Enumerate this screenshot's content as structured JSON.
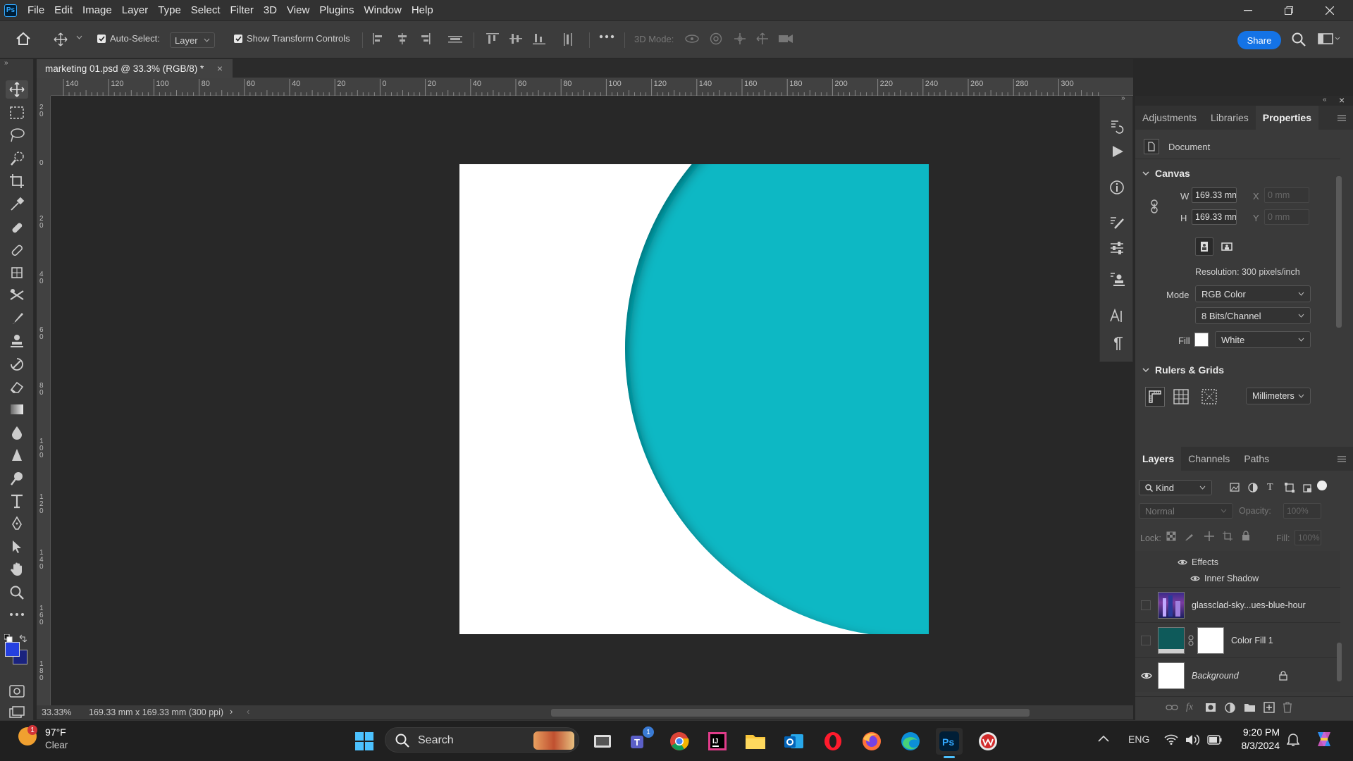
{
  "menu": [
    "File",
    "Edit",
    "Image",
    "Layer",
    "Type",
    "Select",
    "Filter",
    "3D",
    "View",
    "Plugins",
    "Window",
    "Help"
  ],
  "options": {
    "auto_select_label": "Auto-Select:",
    "auto_select_value": "Layer",
    "transform_label": "Show Transform Controls",
    "mode3d_label": "3D Mode:",
    "share_label": "Share"
  },
  "document": {
    "tab_title": "marketing 01.psd @ 33.3% (RGB/8) *",
    "zoom": "33.33%",
    "doc_info": "169.33 mm x 169.33 mm (300 ppi)",
    "shape_color": "#0bb8c4"
  },
  "ruler": {
    "h_ticks": [
      "140",
      "120",
      "100",
      "80",
      "60",
      "40",
      "20",
      "0",
      "20",
      "40",
      "60",
      "80",
      "100",
      "120",
      "140",
      "160",
      "180",
      "200",
      "220",
      "240",
      "260",
      "280",
      "300"
    ],
    "v_ticks": [
      "2\n0",
      "0",
      "2\n0",
      "4\n0",
      "6\n0",
      "8\n0",
      "1\n0\n0",
      "1\n2\n0",
      "1\n4\n0",
      "1\n6\n0",
      "1\n8\n0"
    ]
  },
  "panel_top": {
    "tabs": [
      "Adjustments",
      "Libraries",
      "Properties"
    ],
    "active_tab": "Properties",
    "doc_label": "Document",
    "canvas_head": "Canvas",
    "w_label": "W",
    "w_value": "169.33 mm",
    "h_label": "H",
    "h_value": "169.33 mm",
    "x_label": "X",
    "x_value": "0 mm",
    "y_label": "Y",
    "y_value": "0 mm",
    "resolution": "Resolution: 300 pixels/inch",
    "mode_label": "Mode",
    "mode_value": "RGB Color",
    "depth_value": "8 Bits/Channel",
    "fill_label": "Fill",
    "fill_value": "White",
    "rulers_head": "Rulers & Grids",
    "units_value": "Millimeters"
  },
  "layers_panel": {
    "tabs": [
      "Layers",
      "Channels",
      "Paths"
    ],
    "kind": "Kind",
    "blend": "Normal",
    "opacity_label": "Opacity:",
    "opacity_value": "100%",
    "lock_label": "Lock:",
    "fill_label": "Fill:",
    "fill_value": "100%",
    "effects": "Effects",
    "inner_shadow": "Inner Shadow",
    "layers": [
      {
        "name": "glassclad-sky...ues-blue-hour",
        "visible": false
      },
      {
        "name": "Color Fill 1",
        "visible": false
      },
      {
        "name": "Background",
        "visible": true
      }
    ]
  },
  "taskbar": {
    "weather_temp": "97°F",
    "weather_desc": "Clear",
    "weather_badge": "1",
    "search_label": "Search",
    "teams_badge": "1",
    "lang": "ENG",
    "time": "9:20 PM",
    "date": "8/3/2024"
  }
}
